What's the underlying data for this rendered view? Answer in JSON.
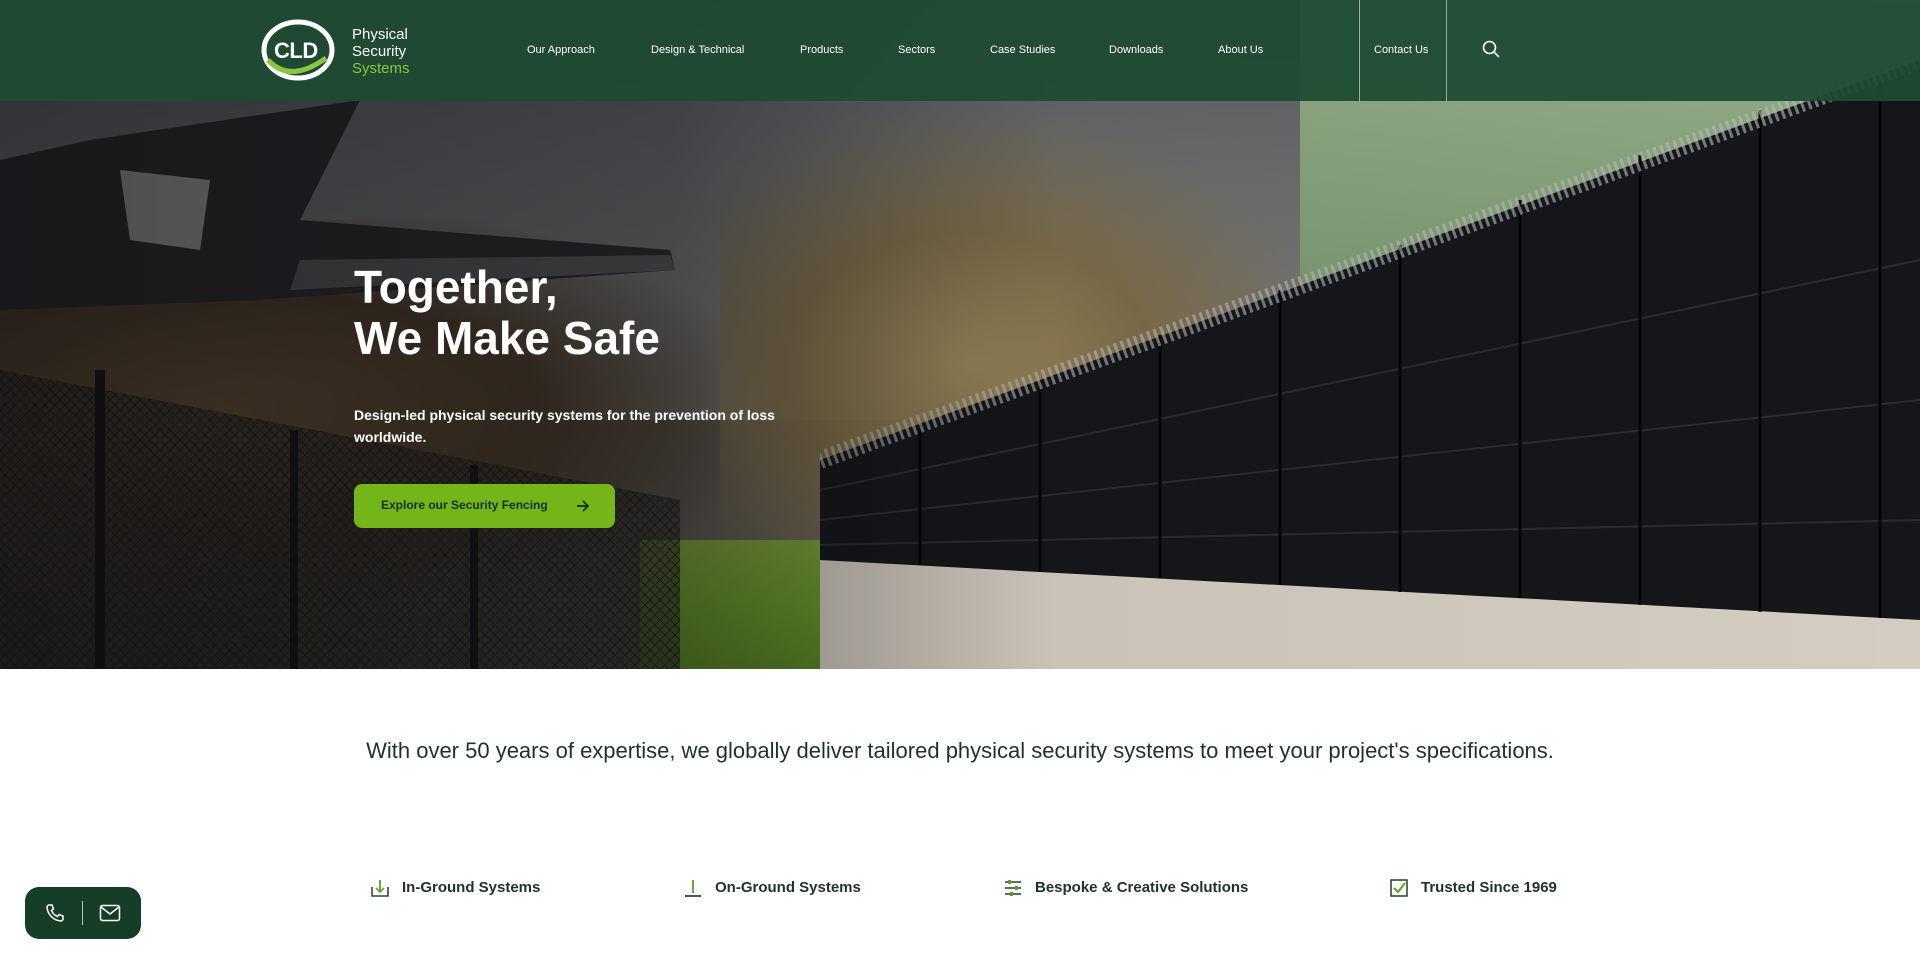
{
  "brand": {
    "mark": "CLD",
    "line1": "Physical",
    "line2": "Security",
    "line3": "Systems"
  },
  "nav": {
    "items": [
      {
        "label": "Our Approach"
      },
      {
        "label": "Design & Technical"
      },
      {
        "label": "Products"
      },
      {
        "label": "Sectors"
      },
      {
        "label": "Case Studies"
      },
      {
        "label": "Downloads"
      },
      {
        "label": "About Us"
      }
    ],
    "contact": "Contact Us",
    "search_icon": "search-icon"
  },
  "hero": {
    "title_line1": "Together,",
    "title_line2": "We Make Safe",
    "subtitle": "Design-led physical security systems for the prevention of loss worldwide.",
    "cta_label": "Explore our Security Fencing",
    "cta_icon": "arrow-right-icon"
  },
  "intro": {
    "text": "With over 50 years of expertise, we globally deliver tailored physical security systems to meet your project's specifications."
  },
  "features": [
    {
      "label": "In-Ground Systems",
      "icon": "in-ground-icon"
    },
    {
      "label": "On-Ground Systems",
      "icon": "on-ground-icon"
    },
    {
      "label": "Bespoke & Creative Solutions",
      "icon": "sliders-icon"
    },
    {
      "label": "Trusted Since 1969",
      "icon": "checkbox-icon"
    }
  ],
  "contact_widget": {
    "phone_icon": "phone-icon",
    "mail_icon": "mail-icon"
  },
  "colors": {
    "header_bg": "#1e4a32",
    "accent_green": "#74b51a",
    "logo_green": "#8cc63f",
    "text_dark": "#1f3327",
    "widget_bg": "#163d28"
  }
}
